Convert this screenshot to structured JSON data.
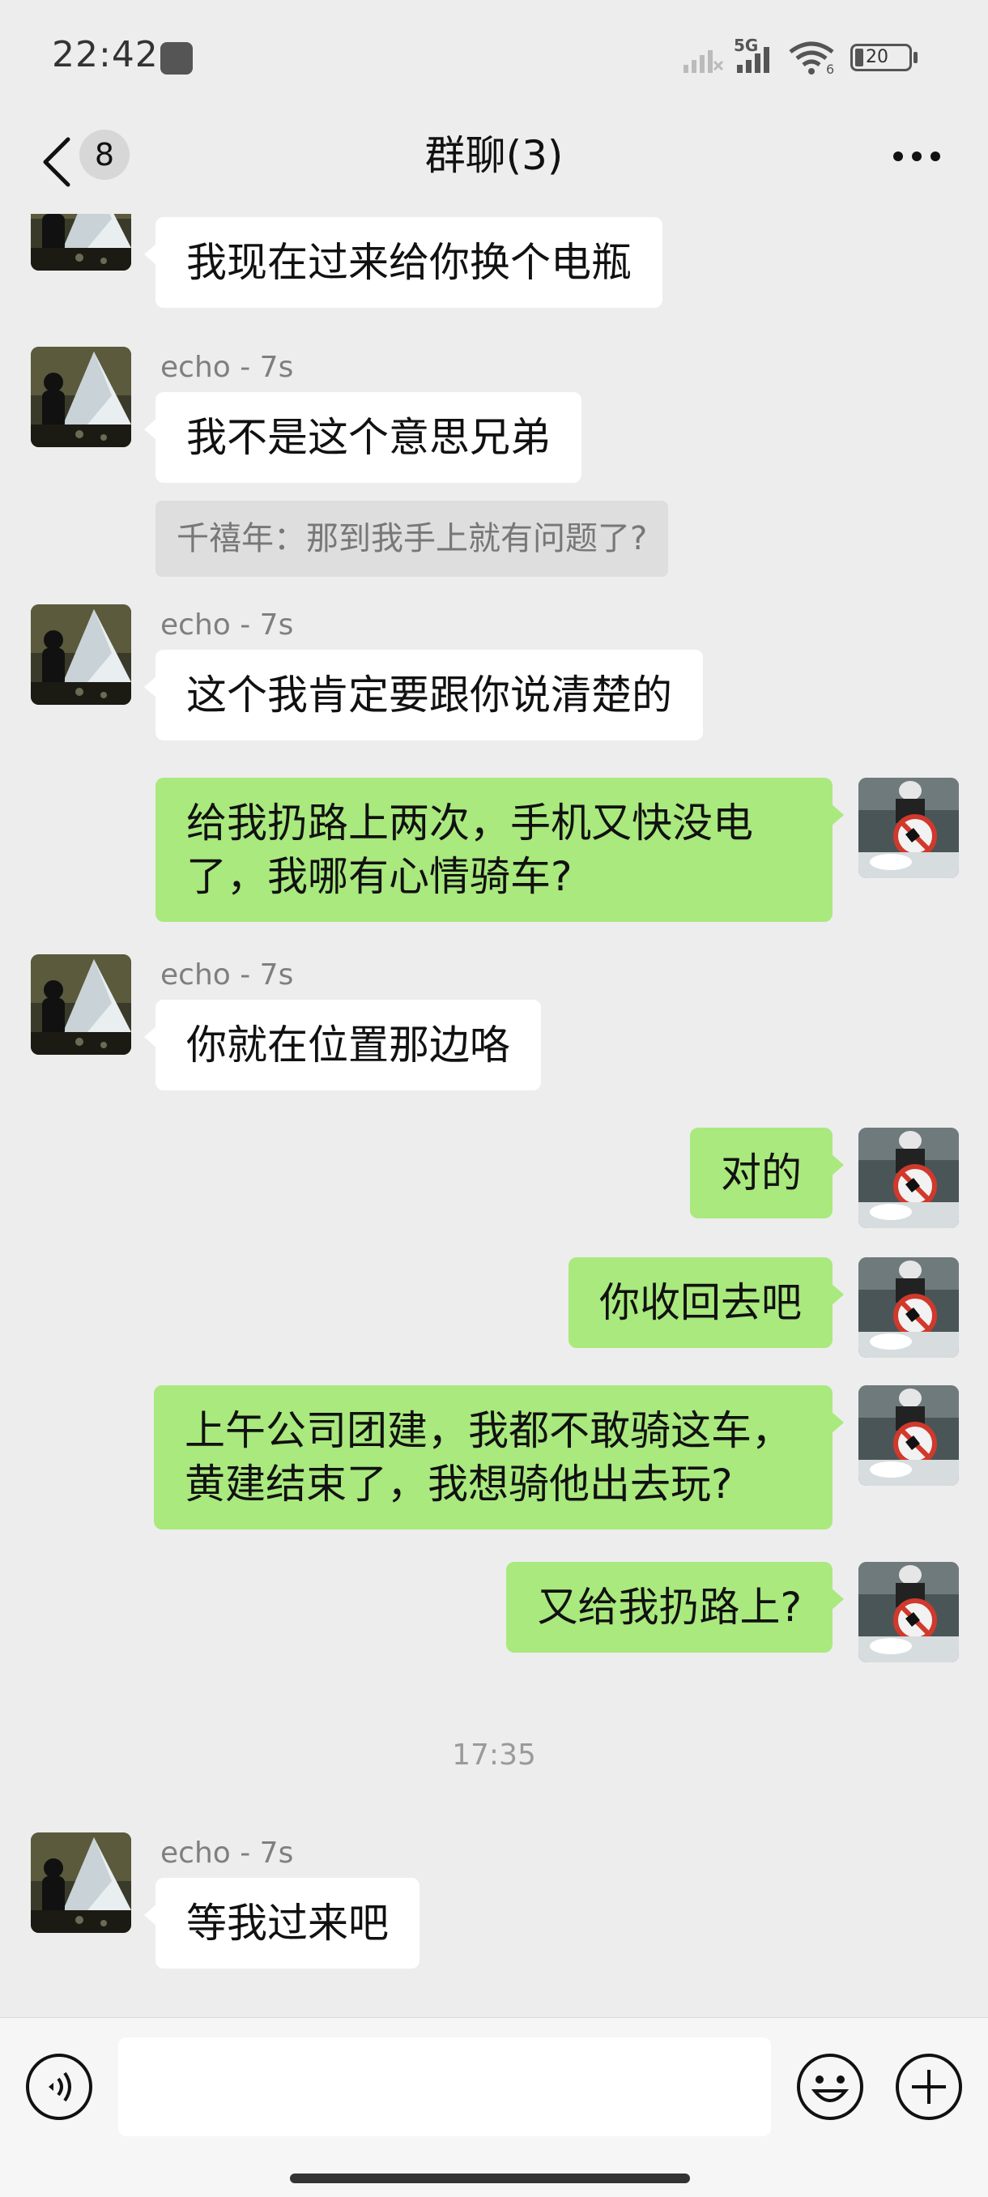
{
  "status_bar": {
    "time": "22:42",
    "network_label": "5G",
    "wifi_label": "6",
    "battery_level": "20"
  },
  "header": {
    "back_icon": "chevron-left-icon",
    "unread_count": "8",
    "title": "群聊(3)",
    "more_icon": "ellipsis-icon"
  },
  "messages": [
    {
      "side": "in",
      "sender": "",
      "text": "我现在过来给你换个电瓶"
    },
    {
      "side": "in",
      "sender": "echo - 7s",
      "text": "我不是这个意思兄弟",
      "quote": "千禧年：那到我手上就有问题了?"
    },
    {
      "side": "in",
      "sender": "echo - 7s",
      "text": "这个我肯定要跟你说清楚的"
    },
    {
      "side": "out",
      "text": "给我扔路上两次，手机又快没电\n了，我哪有心情骑车?"
    },
    {
      "side": "in",
      "sender": "echo - 7s",
      "text": "你就在位置那边咯"
    },
    {
      "side": "out",
      "text": "对的"
    },
    {
      "side": "out",
      "text": "你收回去吧"
    },
    {
      "side": "out",
      "text": "上午公司团建，我都不敢骑这车，\n黄建结束了，我想骑他出去玩?"
    },
    {
      "side": "out",
      "text": "又给我扔路上?"
    },
    {
      "side": "in",
      "sender": "echo - 7s",
      "text": "等我过来吧"
    }
  ],
  "time_divider": "17:35",
  "input_bar": {
    "voice_icon": "voice-icon",
    "input_value": "",
    "emoji_icon": "emoji-icon",
    "plus_icon": "plus-icon"
  },
  "colors": {
    "background": "#ededed",
    "incoming_bubble": "#ffffff",
    "outgoing_bubble": "#a9e97e",
    "quote_bg": "#dedede"
  }
}
